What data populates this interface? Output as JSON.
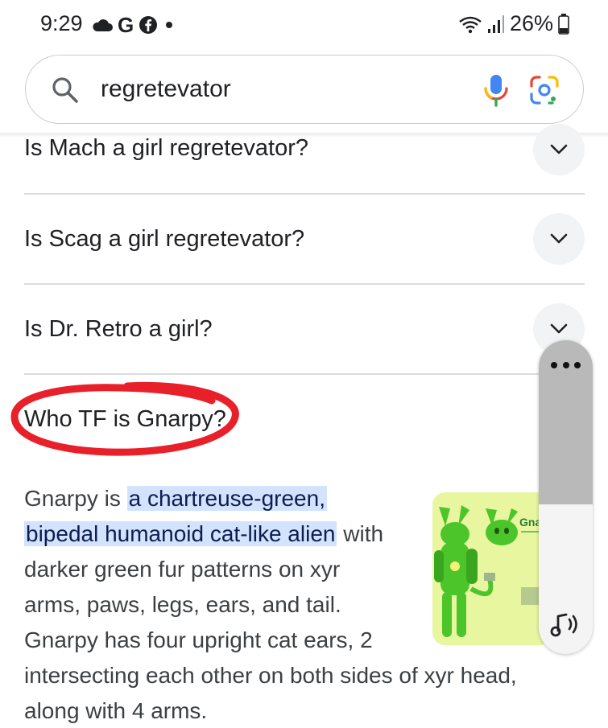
{
  "status_bar": {
    "time": "9:29",
    "left_icons": [
      "cloud-icon",
      "google-g-icon",
      "facebook-icon",
      "notification-dot-icon"
    ],
    "right_icons": [
      "wifi-icon",
      "signal-icon",
      "battery-icon"
    ],
    "battery": "26%"
  },
  "search": {
    "query": "regretevator",
    "icons": [
      "search-icon",
      "mic-icon",
      "google-lens-icon"
    ]
  },
  "questions": [
    {
      "label": "Is Mach a girl regretevator?"
    },
    {
      "label": "Is Scag a girl regretevator?"
    },
    {
      "label": "Is Dr. Retro a girl?"
    },
    {
      "label": "Who TF is Gnarpy?"
    }
  ],
  "answer": {
    "line1_a": "Gnarpy is ",
    "line1_highlight": "a chartreuse-green,",
    "line2_highlight": "bipedal humanoid cat-like alien",
    "line2_b": " with",
    "line3": "darker green fur patterns on xyr",
    "line4": "arms, paws, legs, ears, and tail.",
    "line5": "Gnarpy has four upright cat ears, 2",
    "line6": "intersecting each other on both sides of xyr head,",
    "line7": "along with 4 arms."
  },
  "thumbnail": {
    "caption": "Gna",
    "colors": {
      "background": "#e8f6a0",
      "character": "#4cc52a"
    }
  },
  "floating_panel": {
    "icons": [
      "more-options-icon",
      "audio-icon"
    ]
  },
  "colors": {
    "annotation": "#e8202a",
    "highlight": "#d3e3fd"
  }
}
